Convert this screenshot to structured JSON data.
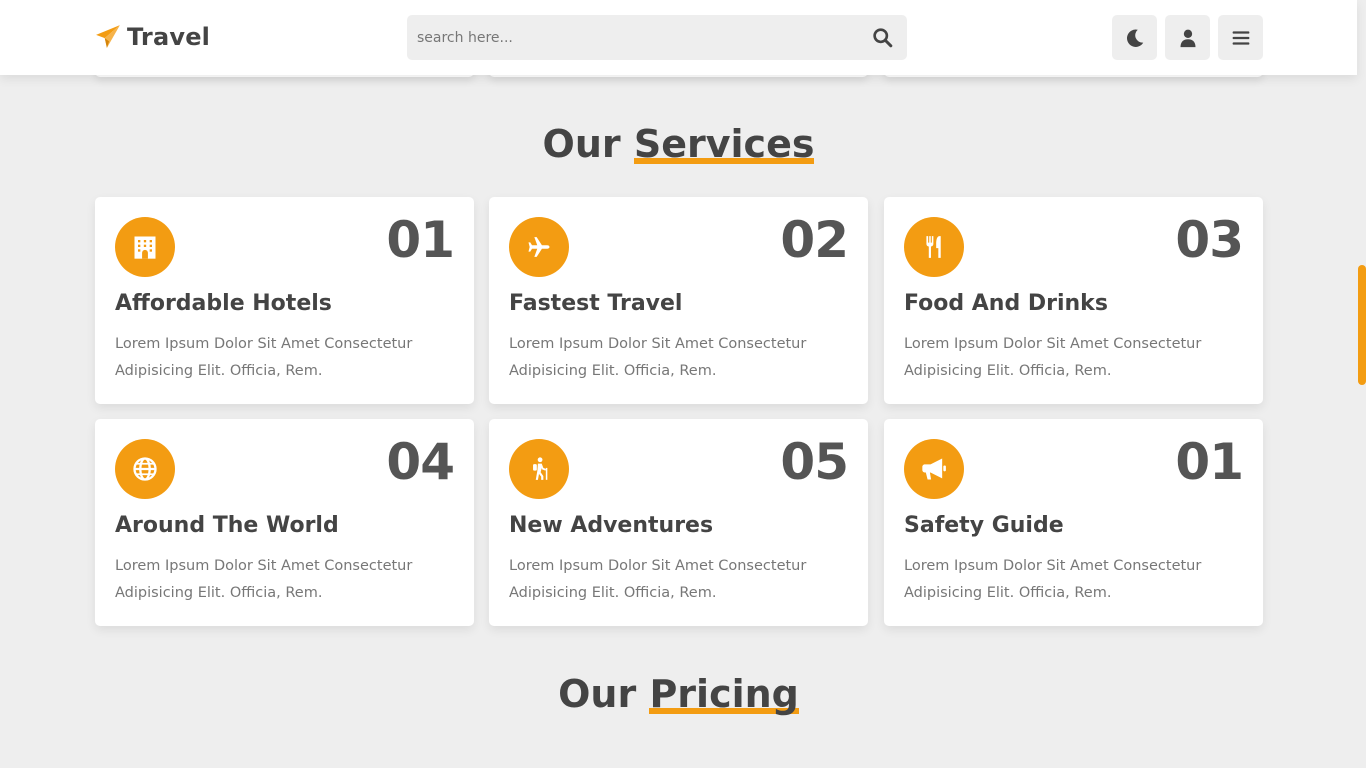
{
  "header": {
    "logo_text": "Travel",
    "search_placeholder": "search here...",
    "icons": {
      "logo": "paper-plane-icon",
      "search": "search-icon",
      "theme": "moon-icon",
      "user": "user-icon",
      "menu": "menu-icon"
    }
  },
  "colors": {
    "accent": "#f39c12",
    "text": "#444444",
    "background": "#eeeeee"
  },
  "services": {
    "heading_prefix": "Our",
    "heading_highlight": "Services",
    "cards": [
      {
        "number": "01",
        "title": "Affordable Hotels",
        "desc": "Lorem Ipsum Dolor Sit Amet Consectetur Adipisicing Elit. Officia, Rem.",
        "icon": "hotel-icon"
      },
      {
        "number": "02",
        "title": "Fastest Travel",
        "desc": "Lorem Ipsum Dolor Sit Amet Consectetur Adipisicing Elit. Officia, Rem.",
        "icon": "plane-icon"
      },
      {
        "number": "03",
        "title": "Food And Drinks",
        "desc": "Lorem Ipsum Dolor Sit Amet Consectetur Adipisicing Elit. Officia, Rem.",
        "icon": "utensils-icon"
      },
      {
        "number": "04",
        "title": "Around The World",
        "desc": "Lorem Ipsum Dolor Sit Amet Consectetur Adipisicing Elit. Officia, Rem.",
        "icon": "globe-icon"
      },
      {
        "number": "05",
        "title": "New Adventures",
        "desc": "Lorem Ipsum Dolor Sit Amet Consectetur Adipisicing Elit. Officia, Rem.",
        "icon": "hiking-icon"
      },
      {
        "number": "01",
        "title": "Safety Guide",
        "desc": "Lorem Ipsum Dolor Sit Amet Consectetur Adipisicing Elit. Officia, Rem.",
        "icon": "bullhorn-icon"
      }
    ]
  },
  "pricing": {
    "heading_prefix": "Our",
    "heading_highlight": "Pricing"
  }
}
